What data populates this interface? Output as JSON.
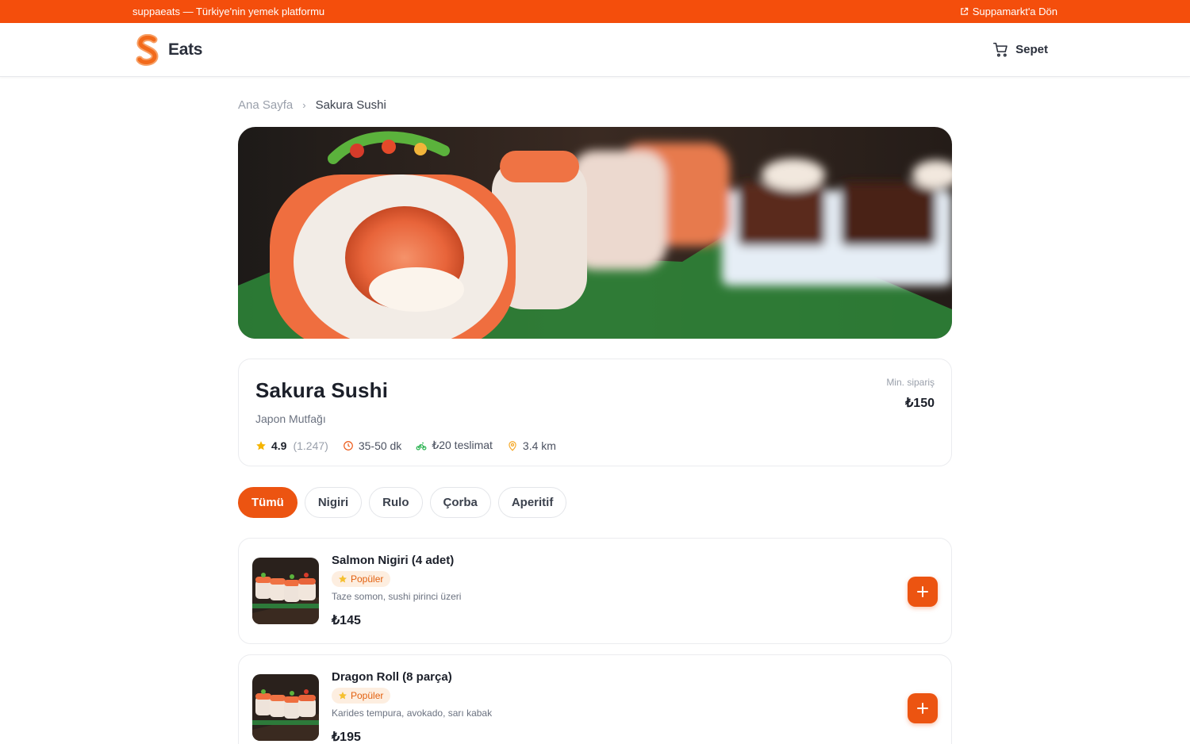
{
  "topbar": {
    "tagline": "suppaeats — Türkiye'nin yemek platformu",
    "back_link": "Suppamarkt'a Dön"
  },
  "header": {
    "brand_name": "Eats",
    "cart_label": "Sepet"
  },
  "breadcrumb": {
    "home": "Ana Sayfa",
    "current": "Sakura Sushi"
  },
  "restaurant": {
    "name": "Sakura Sushi",
    "cuisine": "Japon Mutfağı",
    "rating": "4.9",
    "rating_count": "(1.247)",
    "delivery_time": "35-50 dk",
    "delivery_fee": "₺20 teslimat",
    "distance": "3.4 km",
    "min_order_label": "Min. sipariş",
    "min_order_value": "₺150"
  },
  "categories": [
    {
      "label": "Tümü",
      "active": true
    },
    {
      "label": "Nigiri",
      "active": false
    },
    {
      "label": "Rulo",
      "active": false
    },
    {
      "label": "Çorba",
      "active": false
    },
    {
      "label": "Aperitif",
      "active": false
    }
  ],
  "menu_items": [
    {
      "name": "Salmon Nigiri (4 adet)",
      "badge": "Popüler",
      "description": "Taze somon, sushi pirinci üzeri",
      "price": "₺145"
    },
    {
      "name": "Dragon Roll (8 parça)",
      "badge": "Popüler",
      "description": "Karides tempura, avokado, sarı kabak",
      "price": "₺195"
    }
  ],
  "colors": {
    "accent": "#ec5411",
    "topbar": "#f44e0c",
    "badge_bg": "#fdeee0",
    "star": "#f5b400"
  },
  "icons": {
    "external_link": "external-link-icon",
    "cart": "cart-icon",
    "chevron": "chevron-right-icon",
    "star": "star-icon",
    "clock": "clock-icon",
    "bike": "bike-icon",
    "pin": "map-pin-icon",
    "plus": "plus-icon"
  }
}
